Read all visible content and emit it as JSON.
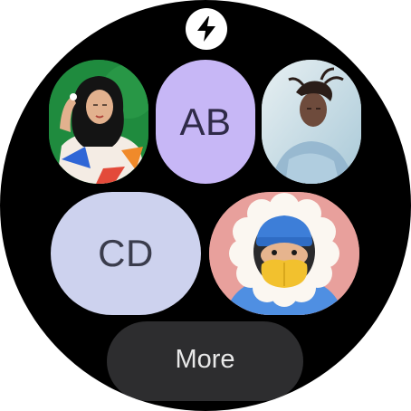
{
  "top_icon": {
    "name": "bolt-icon",
    "color": "#000000"
  },
  "contacts": [
    {
      "kind": "photo",
      "name": "avatar-hijab-woman"
    },
    {
      "kind": "initials",
      "label": "AB",
      "bg": "#c7b7f6",
      "fg": "#2f2a48"
    },
    {
      "kind": "photo",
      "name": "avatar-braided-woman"
    },
    {
      "kind": "initials",
      "label": "CD",
      "bg": "#cdd2ee",
      "fg": "#3a3c4c"
    },
    {
      "kind": "photo",
      "name": "avatar-hooded-character"
    }
  ],
  "more_button": {
    "label": "More"
  },
  "colors": {
    "watch_background": "#000000",
    "button_background": "#2d2d2f",
    "button_text": "#e8e8e8"
  }
}
